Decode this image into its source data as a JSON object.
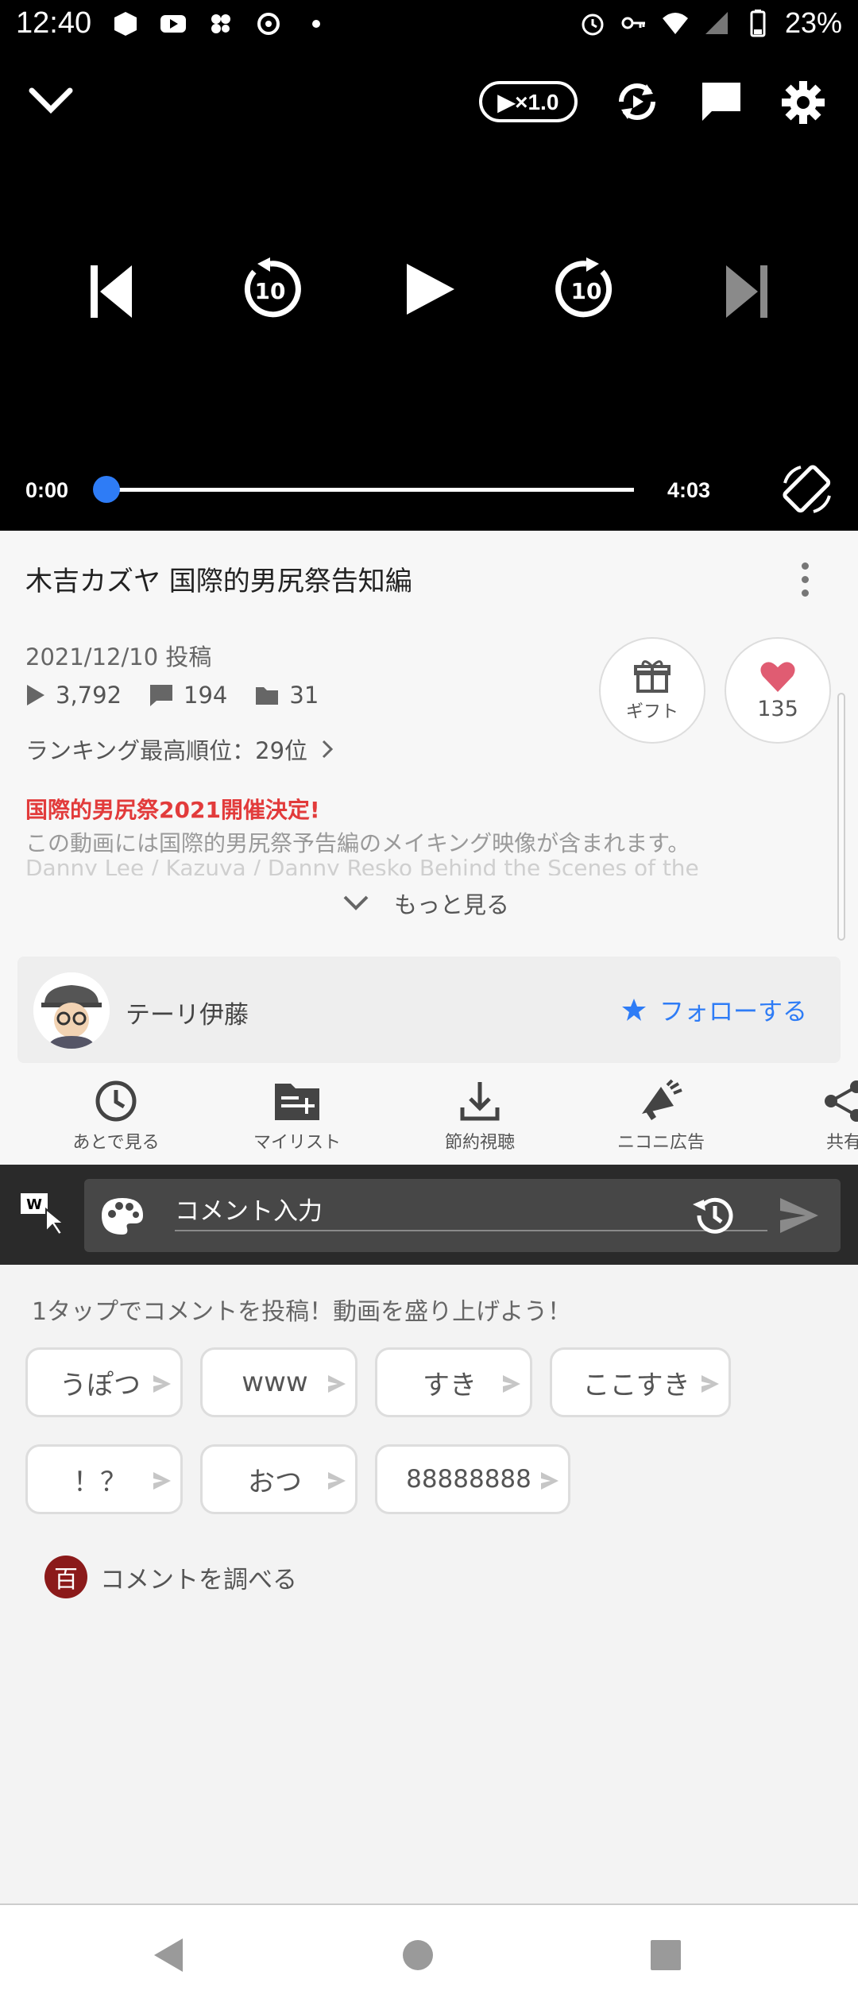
{
  "status_bar": {
    "time": "12:40",
    "battery": "23%"
  },
  "player": {
    "speed_label": "▶×1.0",
    "current_time": "0:00",
    "total_time": "4:03",
    "progress": 0,
    "accent_color": "#2e7cf6"
  },
  "video": {
    "title": "木吉カズヤ 国際的男尻祭告知編",
    "post_date": "2021/12/10 投稿",
    "views": "3,792",
    "comments": "194",
    "mylists": "31",
    "ranking": "ランキング最高順位：29位",
    "gift_label": "ギフト",
    "like_count": "135",
    "desc_red": "国際的男尻祭2021開催決定!",
    "desc_line": "この動画には国際的男尻祭予告編のメイキング映像が含まれます。",
    "desc_fade": "Danny Lee / Kazuya / Danny Resko Behind the Scenes of the",
    "more_label": "もっと見る"
  },
  "channel": {
    "name": "テーリ伊藤",
    "follow_label": "フォローする"
  },
  "actions": [
    {
      "label": "あとで見る",
      "icon": "clock-icon"
    },
    {
      "label": "マイリスト",
      "icon": "mylist-add-icon"
    },
    {
      "label": "節約視聴",
      "icon": "download-icon"
    },
    {
      "label": "ニコニ広告",
      "icon": "megaphone-icon"
    },
    {
      "label": "共有",
      "icon": "share-icon"
    }
  ],
  "comment_bar": {
    "placeholder": "コメント入力"
  },
  "suggestions": {
    "hint": "1タップでコメントを投稿！動画を盛り上げよう！",
    "chips": [
      "うぽつ",
      "www",
      "すき",
      "ここすき",
      "！？",
      "おつ",
      "88888888"
    ],
    "lookup_icon_text": "百",
    "lookup_label": "コメントを調べる"
  }
}
